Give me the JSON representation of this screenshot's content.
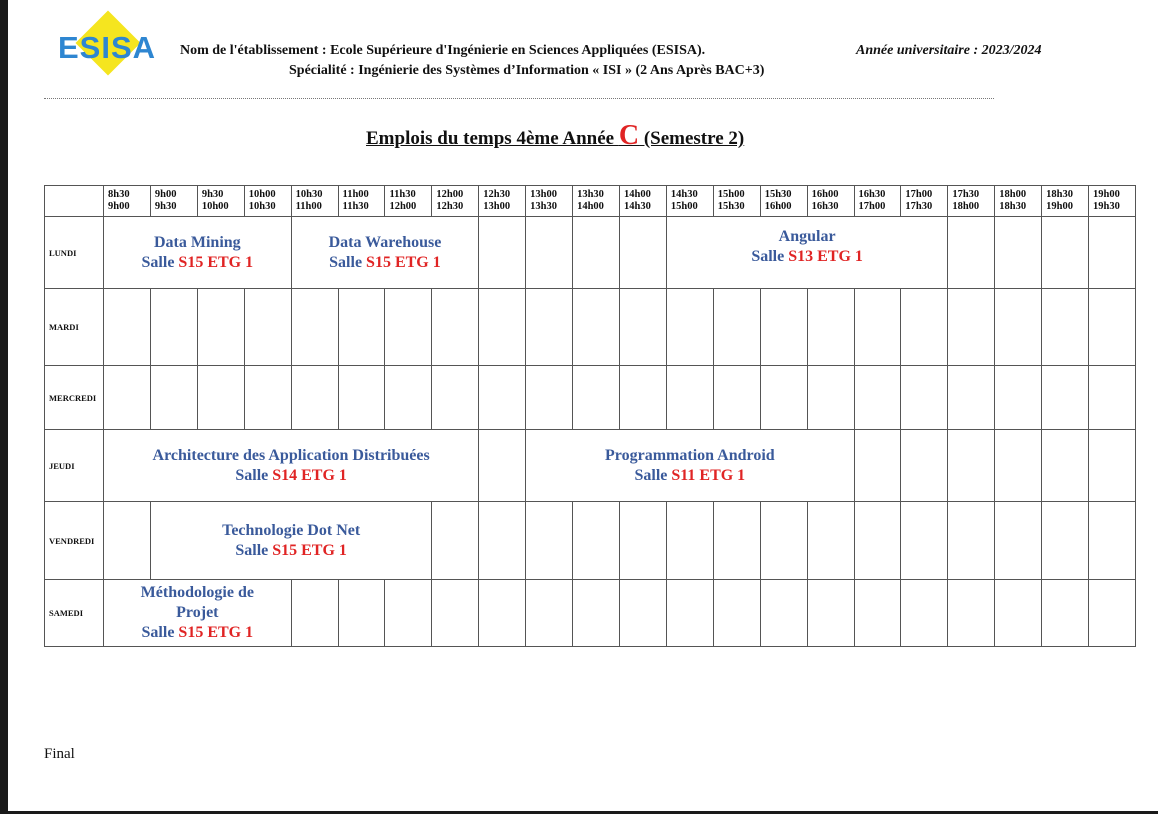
{
  "header": {
    "logo_text": "ESISA",
    "etablissement": "Nom de l'établissement : Ecole Supérieure d'Ingénierie en Sciences Appliquées (ESISA).",
    "annee": "Année universitaire : 2023/2024",
    "specialite": "Spécialité : Ingénierie des Systèmes d’Information « ISI » (2 Ans Après BAC+3)"
  },
  "title": {
    "before": "Emplois du temps 4ème Année ",
    "letter": "C",
    "after": " (Semestre 2)"
  },
  "timeslots": [
    [
      "8h30",
      "9h00"
    ],
    [
      "9h00",
      "9h30"
    ],
    [
      "9h30",
      "10h00"
    ],
    [
      "10h00",
      "10h30"
    ],
    [
      "10h30",
      "11h00"
    ],
    [
      "11h00",
      "11h30"
    ],
    [
      "11h30",
      "12h00"
    ],
    [
      "12h00",
      "12h30"
    ],
    [
      "12h30",
      "13h00"
    ],
    [
      "13h00",
      "13h30"
    ],
    [
      "13h30",
      "14h00"
    ],
    [
      "14h00",
      "14h30"
    ],
    [
      "14h30",
      "15h00"
    ],
    [
      "15h00",
      "15h30"
    ],
    [
      "15h30",
      "16h00"
    ],
    [
      "16h00",
      "16h30"
    ],
    [
      "16h30",
      "17h00"
    ],
    [
      "17h00",
      "17h30"
    ],
    [
      "17h30",
      "18h00"
    ],
    [
      "18h00",
      "18h30"
    ],
    [
      "18h30",
      "19h00"
    ],
    [
      "19h00",
      "19h30"
    ]
  ],
  "days": [
    {
      "name": "LUNDI",
      "cells": [
        {
          "span": 4,
          "course": "Data Mining",
          "salle": "Salle ",
          "room": "S15 ETG 1"
        },
        {
          "span": 4,
          "course": "Data Warehouse",
          "salle": "Salle ",
          "room": "S15 ETG 1"
        },
        {
          "span": 1
        },
        {
          "span": 1
        },
        {
          "span": 1
        },
        {
          "span": 1
        },
        {
          "span": 6,
          "course": "Angular",
          "salle": "Salle ",
          "room": "S13 ETG 1",
          "align": "top"
        },
        {
          "span": 1
        },
        {
          "span": 1
        },
        {
          "span": 1
        },
        {
          "span": 1
        }
      ]
    },
    {
      "name": "MARDI",
      "cells": [
        {
          "span": 1
        },
        {
          "span": 1
        },
        {
          "span": 1
        },
        {
          "span": 1
        },
        {
          "span": 1
        },
        {
          "span": 1
        },
        {
          "span": 1
        },
        {
          "span": 1
        },
        {
          "span": 1
        },
        {
          "span": 1
        },
        {
          "span": 1
        },
        {
          "span": 1
        },
        {
          "span": 1
        },
        {
          "span": 1
        },
        {
          "span": 1
        },
        {
          "span": 1
        },
        {
          "span": 1
        },
        {
          "span": 1
        },
        {
          "span": 1
        },
        {
          "span": 1
        },
        {
          "span": 1
        },
        {
          "span": 1
        }
      ]
    },
    {
      "name": "MERCREDI",
      "cells": [
        {
          "span": 1
        },
        {
          "span": 1
        },
        {
          "span": 1
        },
        {
          "span": 1
        },
        {
          "span": 1
        },
        {
          "span": 1
        },
        {
          "span": 1
        },
        {
          "span": 1
        },
        {
          "span": 1
        },
        {
          "span": 1
        },
        {
          "span": 1
        },
        {
          "span": 1
        },
        {
          "span": 1
        },
        {
          "span": 1
        },
        {
          "span": 1
        },
        {
          "span": 1
        },
        {
          "span": 1
        },
        {
          "span": 1
        },
        {
          "span": 1
        },
        {
          "span": 1
        },
        {
          "span": 1
        },
        {
          "span": 1
        }
      ]
    },
    {
      "name": "JEUDI",
      "cells": [
        {
          "span": 8,
          "course": "Architecture des Application Distribuées",
          "salle": "Salle ",
          "room": "S14 ETG 1"
        },
        {
          "span": 1
        },
        {
          "span": 7,
          "course": "Programmation Android",
          "salle": "Salle ",
          "room": "S11 ETG 1"
        },
        {
          "span": 1
        },
        {
          "span": 1
        },
        {
          "span": 1
        },
        {
          "span": 1
        },
        {
          "span": 1
        },
        {
          "span": 1
        }
      ]
    },
    {
      "name": "VENDREDI",
      "cells": [
        {
          "span": 1
        },
        {
          "span": 6,
          "course": "Technologie Dot Net",
          "salle": "Salle ",
          "room": "S15 ETG 1"
        },
        {
          "span": 1
        },
        {
          "span": 1
        },
        {
          "span": 1
        },
        {
          "span": 1
        },
        {
          "span": 1
        },
        {
          "span": 1
        },
        {
          "span": 1
        },
        {
          "span": 1
        },
        {
          "span": 1
        },
        {
          "span": 1
        },
        {
          "span": 1
        },
        {
          "span": 1
        },
        {
          "span": 1
        },
        {
          "span": 1
        },
        {
          "span": 1
        }
      ]
    },
    {
      "name": "SAMEDI",
      "cells": [
        {
          "span": 4,
          "course": "Méthodologie de Projet",
          "salle": "Salle ",
          "room": "S15 ETG 1"
        },
        {
          "span": 1
        },
        {
          "span": 1
        },
        {
          "span": 1
        },
        {
          "span": 1
        },
        {
          "span": 1
        },
        {
          "span": 1
        },
        {
          "span": 1
        },
        {
          "span": 1
        },
        {
          "span": 1
        },
        {
          "span": 1
        },
        {
          "span": 1
        },
        {
          "span": 1
        },
        {
          "span": 1
        },
        {
          "span": 1
        },
        {
          "span": 1
        },
        {
          "span": 1
        },
        {
          "span": 1
        },
        {
          "span": 1
        }
      ]
    }
  ],
  "footer": {
    "status": "Final"
  },
  "colors": {
    "course_text": "#3a5a9b",
    "room_text": "#e02424",
    "logo_blue": "#2e86d1",
    "logo_yellow": "#f5e51f"
  }
}
